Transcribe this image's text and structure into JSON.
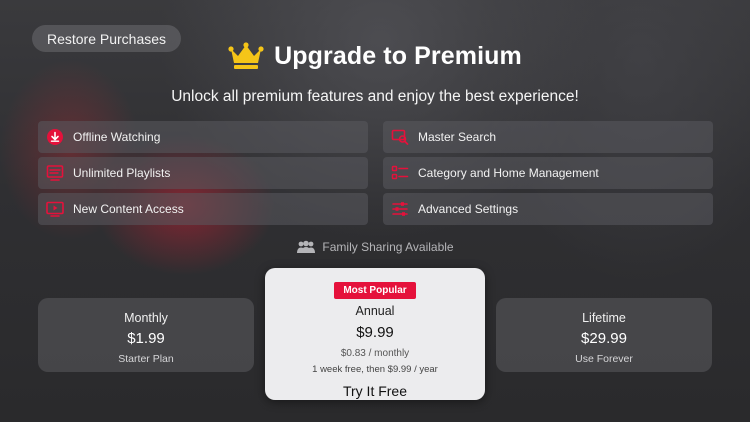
{
  "header": {
    "restore_label": "Restore Purchases",
    "title": "Upgrade to Premium",
    "crown_icon": "crown-icon",
    "crown_color": "#f5c518"
  },
  "subtitle": "Unlock all premium features and enjoy the best experience!",
  "accent_color": "#e5113b",
  "features": [
    {
      "label": "Offline Watching",
      "icon": "download-icon"
    },
    {
      "label": "Master Search",
      "icon": "search-icon"
    },
    {
      "label": "Unlimited Playlists",
      "icon": "playlist-icon"
    },
    {
      "label": "Category and Home Management",
      "icon": "list-manage-icon"
    },
    {
      "label": "New Content Access",
      "icon": "tv-play-icon"
    },
    {
      "label": "Advanced Settings",
      "icon": "sliders-icon"
    }
  ],
  "family_sharing": "Family Sharing Available",
  "plans": {
    "monthly": {
      "name": "Monthly",
      "price": "$1.99",
      "desc": "Starter Plan"
    },
    "annual": {
      "badge": "Most Popular",
      "name": "Annual",
      "price": "$9.99",
      "monthly": "$0.83 / monthly",
      "trial": "1 week free, then $9.99 / year",
      "cta": "Try It Free"
    },
    "lifetime": {
      "name": "Lifetime",
      "price": "$29.99",
      "desc": "Use Forever"
    }
  }
}
